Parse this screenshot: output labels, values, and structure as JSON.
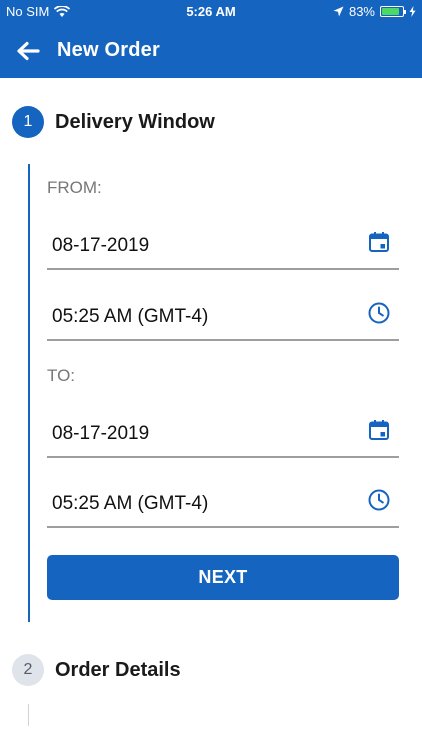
{
  "status_bar": {
    "carrier": "No SIM",
    "time": "5:26 AM",
    "battery_percent": "83%",
    "battery_level": 0.83
  },
  "navbar": {
    "title": "New Order",
    "back_icon": "arrow-left-icon"
  },
  "steps": [
    {
      "number": "1",
      "title": "Delivery Window",
      "state": "active"
    },
    {
      "number": "2",
      "title": "Order Details",
      "state": "inactive"
    }
  ],
  "delivery_window": {
    "from_label": "FROM:",
    "from_date": "08-17-2019",
    "from_time": "05:25 AM (GMT-4)",
    "to_label": "TO:",
    "to_date": "08-17-2019",
    "to_time": "05:25 AM (GMT-4)",
    "next_label": "NEXT"
  },
  "colors": {
    "primary": "#1565c0",
    "inactive_step": "#dfe3ea",
    "divider": "#9e9e9e"
  }
}
